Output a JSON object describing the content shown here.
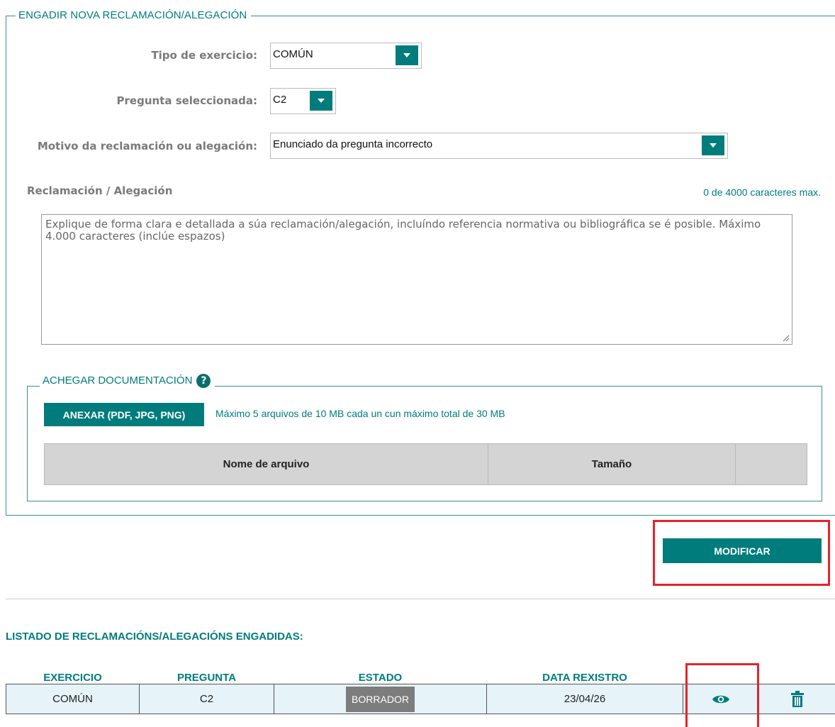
{
  "form": {
    "legend": "ENGADIR NOVA RECLAMACIÓN/ALEGACIÓN",
    "tipo_label": "Tipo de exercicio:",
    "tipo_value": "COMÚN",
    "pregunta_label": "Pregunta seleccionada:",
    "pregunta_value": "C2",
    "motivo_label": "Motivo da reclamación ou alegación:",
    "motivo_value": "Enunciado da pregunta incorrecto",
    "reclamacion_label": "Reclamación / Alegación",
    "char_counter": "0 de 4000 caracteres max.",
    "textarea_placeholder": "Explique de forma clara e detallada a súa reclamación/alegación, incluíndo referencia normativa ou bibliográfica se é posible. Máximo 4.000 caracteres (inclúe espazos)",
    "textarea_value": ""
  },
  "docs": {
    "legend": "ACHEGAR DOCUMENTACIÓN",
    "help_icon": "?",
    "attach_button": "ANEXAR (PDF, JPG, PNG)",
    "limits_text": "Máximo 5 arquivos de 10 MB cada un cun máximo total de 30 MB",
    "columns": [
      "Nome de arquivo",
      "Tamaño",
      ""
    ]
  },
  "actions": {
    "modify_button": "MODIFICAR"
  },
  "list": {
    "title": "LISTADO DE RECLAMACIÓNS/ALEGACIÓNS ENGADIDAS:",
    "columns": [
      "EXERCICIO",
      "PREGUNTA",
      "ESTADO",
      "DATA REXISTRO",
      "",
      ""
    ],
    "rows": [
      {
        "exercicio": "COMÚN",
        "pregunta": "C2",
        "estado": "BORRADOR",
        "data": "23/04/26",
        "view_icon": "eye-icon",
        "delete_icon": "trash-icon"
      }
    ]
  },
  "colors": {
    "accent": "#007c7c",
    "highlight_box": "#e3242b",
    "badge": "#7d7d7d",
    "row_bg": "#e6f3f8",
    "table_header_bg": "#d4d4d4"
  }
}
